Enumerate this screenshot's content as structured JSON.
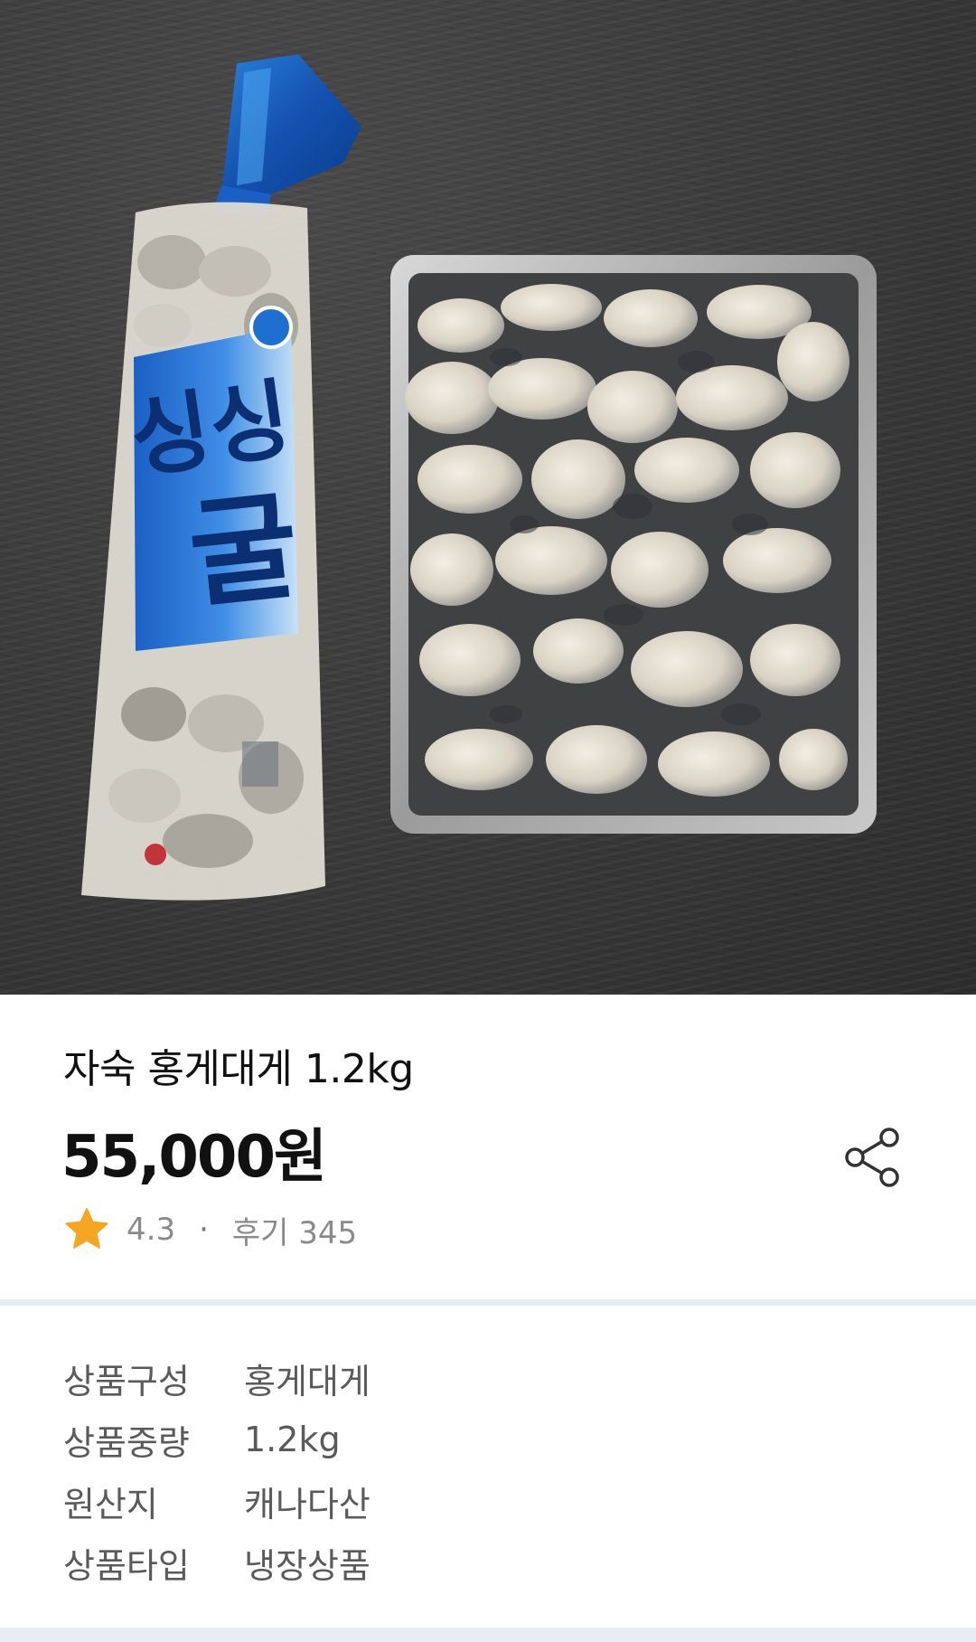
{
  "product": {
    "title": "자숙 홍게대게 1.2kg",
    "price": "55,000원",
    "rating": "4.3",
    "separator": "·",
    "reviews": "후기 345",
    "photo_package_text": "싱싱 굴",
    "share_icon": "share-icon",
    "star_icon": "star-icon",
    "star_color": "#F5A623"
  },
  "specs": [
    {
      "key": "상품구성",
      "value": "홍게대게"
    },
    {
      "key": "상품중량",
      "value": "1.2kg"
    },
    {
      "key": "원산지",
      "value": "캐나다산"
    },
    {
      "key": "상품타입",
      "value": "냉장상품"
    }
  ],
  "colors": {
    "divider": "#E6EDF5",
    "text_primary": "#111111",
    "text_secondary": "#8A8A8A",
    "spec_text": "#5A5A5A"
  }
}
